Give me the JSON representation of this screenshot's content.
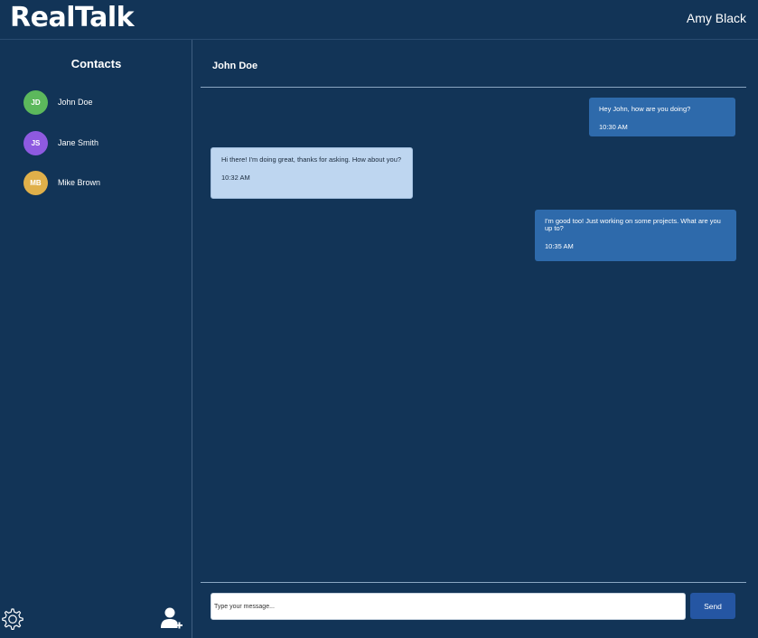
{
  "app": {
    "title": "RealTalk",
    "user": "Amy Black"
  },
  "sidebar": {
    "title": "Contacts",
    "contacts": [
      {
        "initials": "JD",
        "name": "John Doe",
        "color": "#5cb85c"
      },
      {
        "initials": "JS",
        "name": "Jane Smith",
        "color": "#8e5ae0"
      },
      {
        "initials": "MB",
        "name": "Mike Brown",
        "color": "#e0b04a"
      }
    ],
    "settings_icon": "gear-icon",
    "add_contact_icon": "add-user-icon"
  },
  "chat": {
    "contact_name": "John Doe",
    "messages": [
      {
        "direction": "sent",
        "text": "Hey John, how are you doing?",
        "time": "10:30 AM"
      },
      {
        "direction": "received",
        "text": "Hi there! I'm doing great, thanks for asking. How about you?",
        "time": "10:32 AM"
      },
      {
        "direction": "sent",
        "text": "I'm good too! Just working on some projects. What are you up to?",
        "time": "10:35 AM"
      }
    ],
    "input_placeholder": "Type your message...",
    "send_label": "Send"
  },
  "colors": {
    "background": "#123457",
    "sent_bubble": "#2e6aab",
    "received_bubble": "#bed6f0",
    "send_button": "#2556a3"
  }
}
